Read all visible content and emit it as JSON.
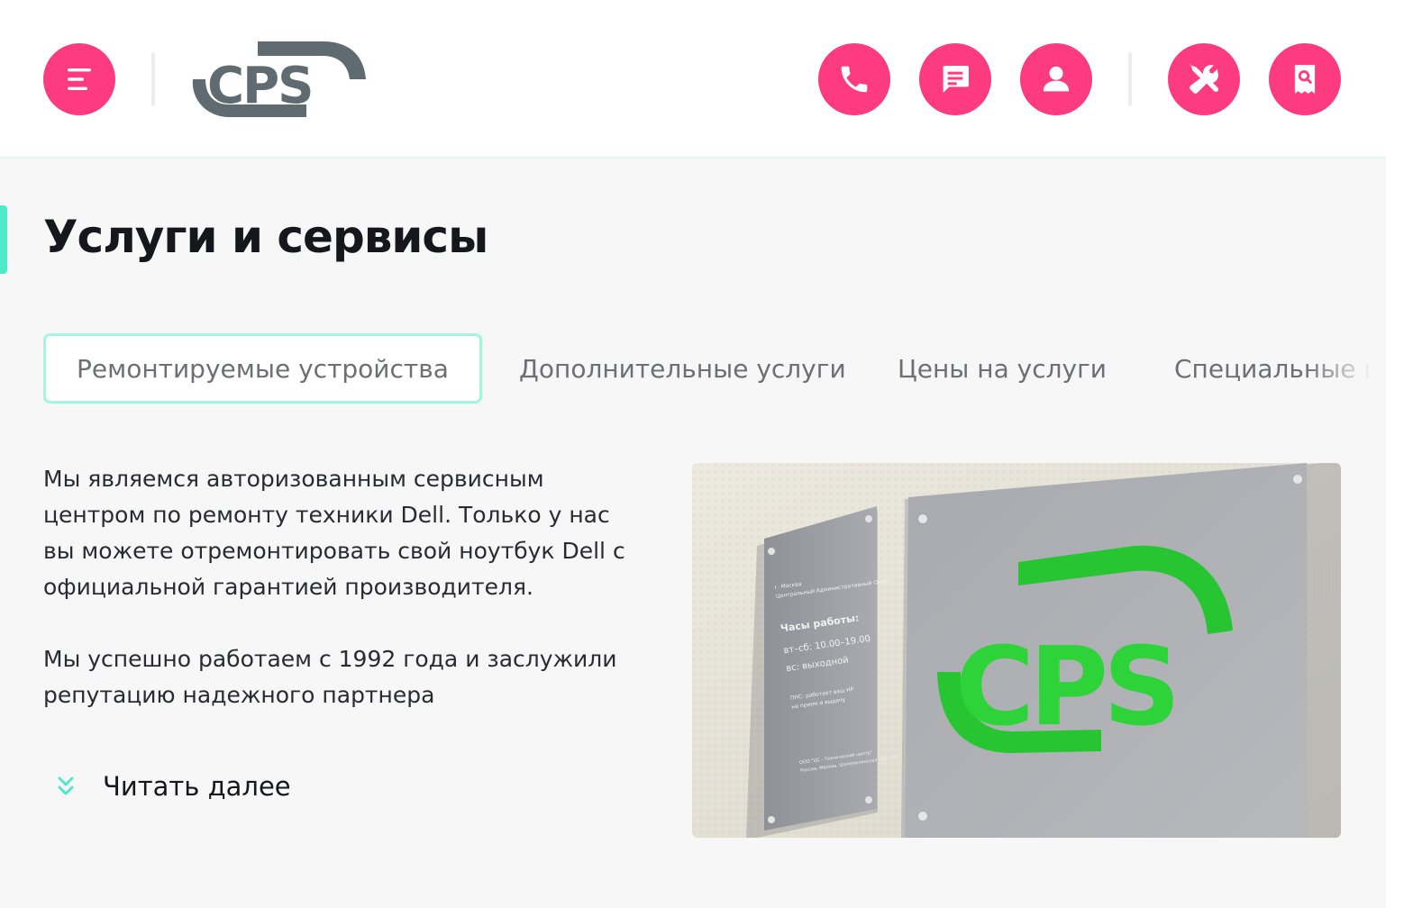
{
  "header": {
    "logo_text": "CPS",
    "buttons": [
      {
        "name": "menu",
        "icon": "menu-icon"
      },
      {
        "name": "phone",
        "icon": "phone-icon"
      },
      {
        "name": "chat",
        "icon": "chat-icon"
      },
      {
        "name": "account",
        "icon": "user-icon"
      },
      {
        "name": "service",
        "icon": "tools-icon"
      },
      {
        "name": "track-order",
        "icon": "receipt-search-icon"
      }
    ],
    "accent_color": "#ff3b7f"
  },
  "main": {
    "title": "Услуги и сервисы",
    "tabs": [
      {
        "label": "Ремонтируемые устройства",
        "active": true
      },
      {
        "label": "Дополнительные услуги",
        "active": false
      },
      {
        "label": "Цены на услуги",
        "active": false
      },
      {
        "label": "Специальные цен",
        "active": false
      }
    ],
    "paragraphs": [
      "Мы являемся авторизованным сервисным центром по ремонту техники Dell. Только у нас вы можете отремонтировать свой ноутбук Dell с официальной гарантией производителя.",
      "Мы успешно работаем с 1992 года и заслужили репутацию надежного партнера"
    ],
    "read_more_label": "Читать далее",
    "photo": {
      "sign_logo_text": "CPS",
      "plate_lines": [
        "г. Москва",
        "Центральный Административный Округ",
        "Часы работы:",
        "вт–сб: 10.00–19.00",
        "вс: выходной",
        "ПНС: работает ваш HP",
        "на прием и выдачу",
        "ООО \"ЦС - Технический центр\"",
        "Россия, Москва, Шелепихинская наб., 18"
      ]
    },
    "highlight_color": "#4fe8c9"
  }
}
